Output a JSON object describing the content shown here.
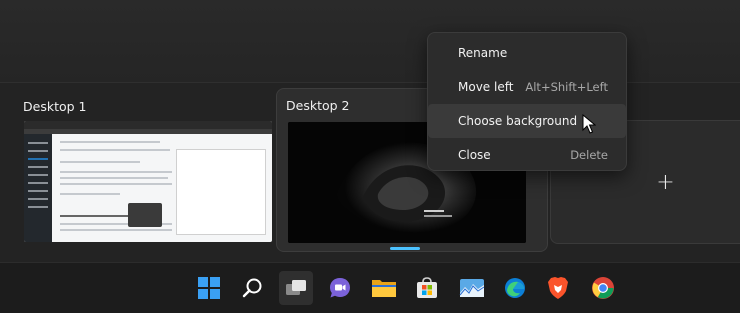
{
  "desktops": [
    {
      "title": "Desktop 1"
    },
    {
      "title": "Desktop 2"
    }
  ],
  "new_desktop": {
    "label": "+"
  },
  "context_menu": {
    "items": [
      {
        "label": "Rename",
        "shortcut": ""
      },
      {
        "label": "Move left",
        "shortcut": "Alt+Shift+Left"
      },
      {
        "label": "Choose background",
        "shortcut": ""
      },
      {
        "label": "Close",
        "shortcut": "Delete"
      }
    ]
  },
  "taskbar": {
    "icons": [
      "windows-start-icon",
      "search-icon",
      "task-view-icon",
      "chat-icon",
      "file-explorer-icon",
      "microsoft-store-icon",
      "photos-icon",
      "edge-icon",
      "brave-icon",
      "chrome-icon"
    ]
  },
  "colors": {
    "accent": "#4cc2ff",
    "menu_bg": "#2c2c2c",
    "taskbar_bg": "#1c1c1c"
  }
}
